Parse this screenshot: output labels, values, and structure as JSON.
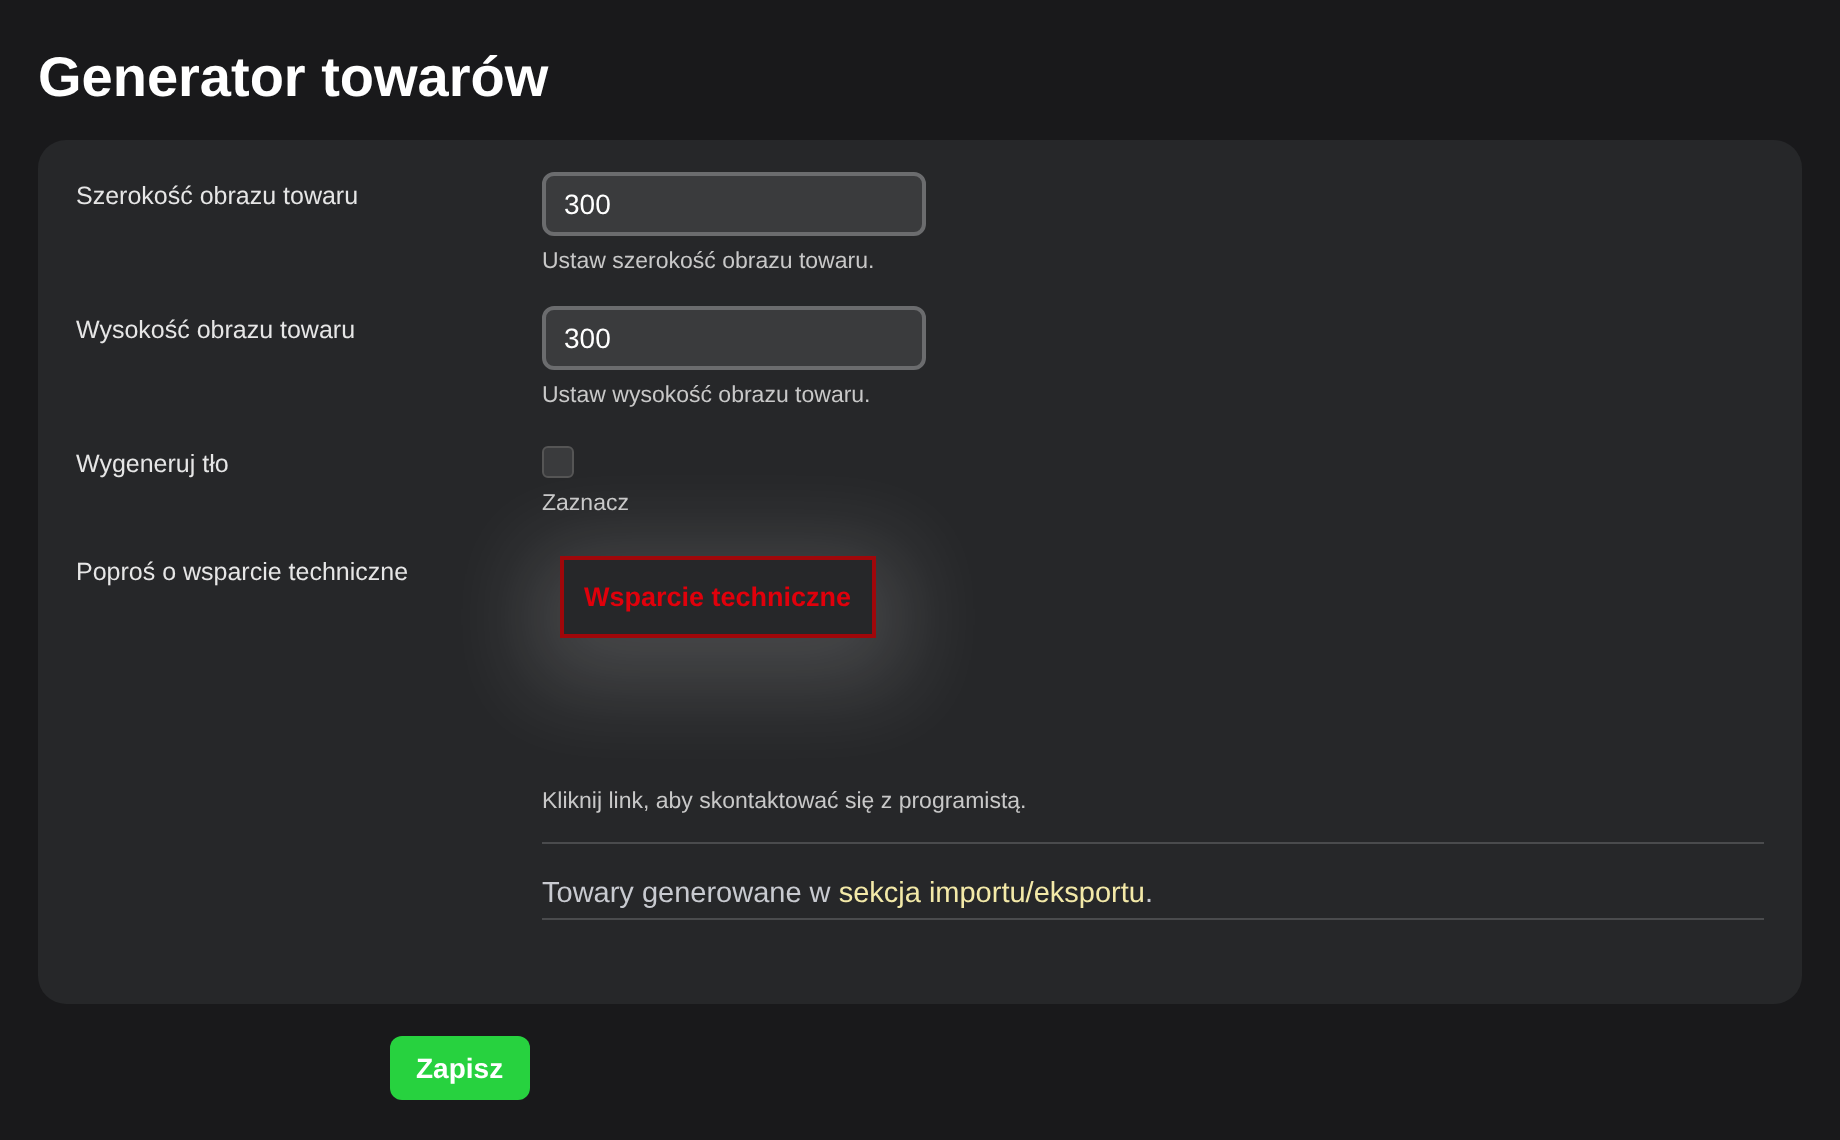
{
  "title": "Generator towarów",
  "rows": [
    {
      "kind": "number",
      "label": "Szerokość obrazu towaru",
      "value": "300",
      "hint": "Ustaw szerokość obrazu towaru."
    },
    {
      "kind": "number",
      "label": "Wysokość obrazu towaru",
      "value": "300",
      "hint": "Ustaw wysokość obrazu towaru."
    },
    {
      "kind": "checkbox",
      "label": "Wygeneruj tło",
      "checked": false,
      "hint": "Zaznacz"
    },
    {
      "kind": "button",
      "label": "Poproś o wsparcie techniczne",
      "button": "Wsparcie techniczne",
      "hint": "Kliknij link, aby skontaktować się z programistą."
    }
  ],
  "note": {
    "prefix": "Towary generowane w ",
    "link": "sekcja importu/eksportu",
    "suffix": "."
  },
  "save": "Zapisz"
}
